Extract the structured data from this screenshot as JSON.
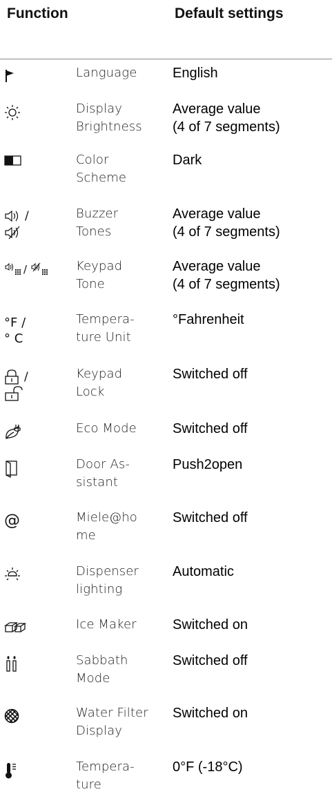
{
  "header": {
    "function_label": "Function",
    "default_label": "Default settings"
  },
  "rows": [
    {
      "icon": "flag-icon",
      "name": "Language",
      "value": "English"
    },
    {
      "icon": "brightness-icon",
      "name": "Display\nBrightness",
      "value": "Average value\n(4 of 7 segments)"
    },
    {
      "icon": "color-scheme-icon",
      "name": "Color\nScheme",
      "value": "Dark"
    },
    {
      "icon": "buzzer-icon",
      "icon_text": "🕪) /\n🔇",
      "name": "Buzzer\nTones",
      "value": "Average value\n(4 of 7 segments)"
    },
    {
      "icon": "keypad-tone-icon",
      "name": "Keypad\nTone",
      "value": "Average value\n(4 of 7 segments)"
    },
    {
      "icon": "temperature-unit-icon",
      "icon_text": "°F /\n° C",
      "name": "Tempera-\nture Unit",
      "value": "°Fahrenheit"
    },
    {
      "icon": "lock-icon",
      "name": "Keypad\nLock",
      "value": "Switched off"
    },
    {
      "icon": "eco-mode-icon",
      "name": "Eco Mode",
      "value": "Switched off"
    },
    {
      "icon": "door-icon",
      "name": "Door As-\nsistant",
      "value": "Push2open"
    },
    {
      "icon": "at-icon",
      "icon_text": "@",
      "name": "Miele@ho\nme",
      "value": "Switched off"
    },
    {
      "icon": "light-icon",
      "name": "Dispenser\nlighting",
      "value": "Automatic"
    },
    {
      "icon": "ice-maker-icon",
      "name": "Ice Maker",
      "value": "Switched on"
    },
    {
      "icon": "sabbath-icon",
      "name": "Sabbath\nMode",
      "value": "Switched off"
    },
    {
      "icon": "water-filter-icon",
      "name": "Water Filter\nDisplay",
      "value": "Switched on"
    },
    {
      "icon": "thermometer-icon",
      "name": "Tempera-\nture",
      "value": "0°F (-18°C)"
    }
  ]
}
